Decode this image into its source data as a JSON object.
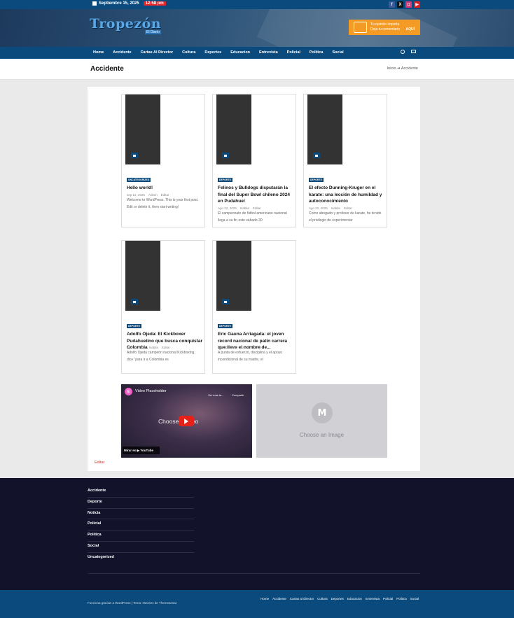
{
  "topbar": {
    "date": "Septiembre 15, 2025",
    "time": "12:58 pm",
    "socials": [
      {
        "icon": "facebook-icon",
        "glyph": "f",
        "color": "#3b5998"
      },
      {
        "icon": "x-icon",
        "glyph": "X",
        "color": "#111111"
      },
      {
        "icon": "instagram-icon",
        "glyph": "◘",
        "color": "#d8357b"
      },
      {
        "icon": "youtube-icon",
        "glyph": "▶",
        "color": "#e02020"
      }
    ]
  },
  "header": {
    "logo": "Tropezón",
    "logo_sub": "El Diario",
    "ad": {
      "line1": "Tu opinión importa",
      "line2": "Deja tu comentario",
      "cta": "AQUÍ"
    }
  },
  "nav": {
    "items": [
      "Home",
      "Accidente",
      "Cartas Al Director",
      "Cultura",
      "Deportes",
      "Educacion",
      "Entrevista",
      "Policial",
      "Politica",
      "Social"
    ]
  },
  "breadcrumb": {
    "title": "Accidente",
    "trail": "Inicio ➜ Accidente"
  },
  "posts": [
    {
      "badge": "UNCATEGORIZED",
      "title": "Hello world!",
      "date": "sep 12, 2025",
      "author": "Admin",
      "edit": "Editar",
      "excerpt": "Welcome to WordPress. This is your first post. Edit or delete it, then start writing!"
    },
    {
      "badge": "DEPORTE",
      "title": "Felinos y Bulldogs disputarán la final del Super Bowl chileno 2024 en Pudahuel",
      "date": "Ago 22, 2025",
      "author": "Isabite",
      "edit": "Editar",
      "excerpt": "El campeonato de fútbol americano nacional llega a su fin este sábado 30"
    },
    {
      "badge": "DEPORTE",
      "title": "El efecto Dunning-Kruger en el karate: una lección de humildad y autoconocimiento",
      "date": "Ago 22, 2025",
      "author": "Isabite",
      "edit": "Editar",
      "excerpt": "Como abogado y profesor de karate, he tenido el privilegio de experimentar"
    },
    {
      "badge": "DEPORTE",
      "title": "Adolfo Ojeda: El Kickboxer Pudahuelino que busca conquistar Colombia",
      "date": "Ago 22, 2025",
      "author": "Isabite",
      "edit": "Editar",
      "excerpt": "Adolfo Ojeda campeón nacional Kickboxing, dice “para ir a Colombia es"
    },
    {
      "badge": "DEPORTE",
      "title": "Eric Gauna Arriagada: el joven récord nacional de patín carrera que lleve el nombre de...",
      "date": "Ago 22, 2025",
      "author": "Isabite",
      "edit": "Editar",
      "excerpt": "A punta de esfuerzo, disciplina y el apoyo incondicional de su madre, el"
    }
  ],
  "video": {
    "logo": "E",
    "title": "Video Placeholder",
    "later": "Ver más ta...",
    "share": "Compartir",
    "choose": "Choose   r video",
    "watch": "Mirar en ▶ YouTube"
  },
  "image_placeholder": {
    "label": "Choose an Image",
    "mark": "M"
  },
  "edit_link": "Editar",
  "footer": {
    "categories": [
      "Accidente",
      "Deporte",
      "Noticia",
      "Policial",
      "Politica",
      "Social",
      "Uncategorized"
    ],
    "credit": "Funciona gracias a WordPress | Tema: Newses de Themeansar.",
    "menu": [
      "Home",
      "Accidente",
      "Cartas al director",
      "Cultura",
      "Deportes",
      "Educacion",
      "Entrevista",
      "Policial",
      "Politica",
      "Social"
    ]
  }
}
